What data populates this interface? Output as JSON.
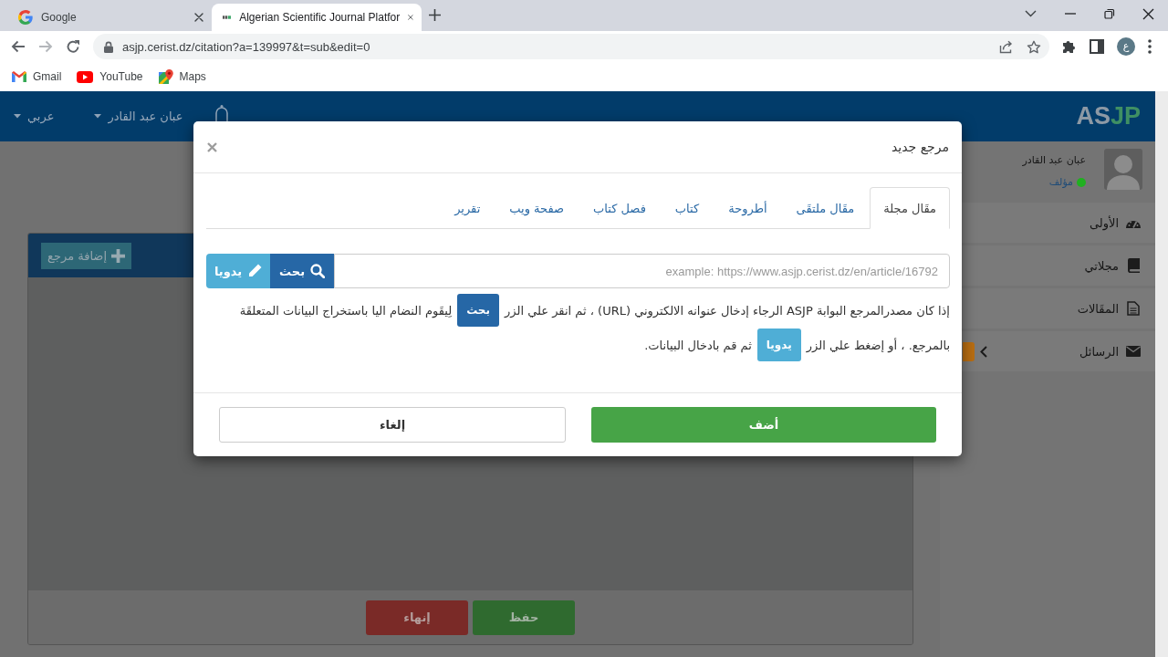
{
  "browser": {
    "tabs": [
      {
        "title": "Algerian Scientific Journal Platfor",
        "kind": "site",
        "selected": true
      },
      {
        "title": "Google",
        "kind": "google",
        "selected": false
      }
    ],
    "forward_disabled": true,
    "url": "asjp.cerist.dz/citation?a=139997&t=sub&edit=0",
    "profile_initial": "ع",
    "bookmarks": [
      {
        "label": "Maps",
        "kind": "maps"
      },
      {
        "label": "YouTube",
        "kind": "youtube"
      },
      {
        "label": "Gmail",
        "kind": "gmail"
      }
    ]
  },
  "header": {
    "logo": {
      "part_1": "AS",
      "part_2": "JP"
    },
    "user_menu": "عبان عبد القادر",
    "language_menu": "عربي"
  },
  "sidebar": {
    "user_name": "عبان عبد القادر",
    "role": "مؤلف",
    "online": true,
    "items": [
      {
        "label": "الأولى",
        "kind": "dashboard",
        "badge": false,
        "expandable": false
      },
      {
        "label": "مجلاتي",
        "kind": "book",
        "badge": false,
        "expandable": false
      },
      {
        "label": "المقَالات",
        "kind": "file",
        "badge": false,
        "expandable": false
      },
      {
        "label": "الرسائل",
        "kind": "envelope",
        "badge": true,
        "expandable": true
      }
    ]
  },
  "content": {
    "add_button": "إضافة مرجع",
    "buttons": [
      {
        "label": "حفظ",
        "kind": "save"
      },
      {
        "label": "إنهاء",
        "kind": "finish"
      }
    ]
  },
  "modal": {
    "title": "مرجع جديد",
    "tabs": [
      {
        "label": "مقَال مجلة",
        "selected": true
      },
      {
        "label": "مقَال ملتقَى",
        "selected": false
      },
      {
        "label": "أطروحة",
        "selected": false
      },
      {
        "label": "كتاب",
        "selected": false
      },
      {
        "label": "فصل كتاب",
        "selected": false
      },
      {
        "label": "صفحة ويب",
        "selected": false
      },
      {
        "label": "تقرير",
        "selected": false
      }
    ],
    "url_field": {
      "placeholder": "example: https://www.asjp.cerist.dz/en/article/16792"
    },
    "search_button": "بحث",
    "manual_button": "يدويا",
    "instructions": [
      [
        {
          "kind": "text",
          "text": "إذا كان مصدرالمرجع البوابة ASJP الرجاء إدخال عنوانه الالكتروني (URL) ، ثم انقر علي الزر"
        },
        {
          "kind": "search",
          "text": "بحث"
        },
        {
          "kind": "text",
          "text": "لِيقَوم النضام اليا باستخراج البيانات المتعلقَة"
        }
      ],
      [
        {
          "kind": "text",
          "text": "بالمرجع. ، أو إضغط علي الزر"
        },
        {
          "kind": "manual",
          "text": "يدويا"
        },
        {
          "kind": "text",
          "text": "ثم قم بادخال البيانات."
        }
      ]
    ],
    "buttons": [
      {
        "label": "أضف",
        "kind": "primary"
      },
      {
        "label": "إلغاء",
        "kind": "default"
      }
    ]
  }
}
